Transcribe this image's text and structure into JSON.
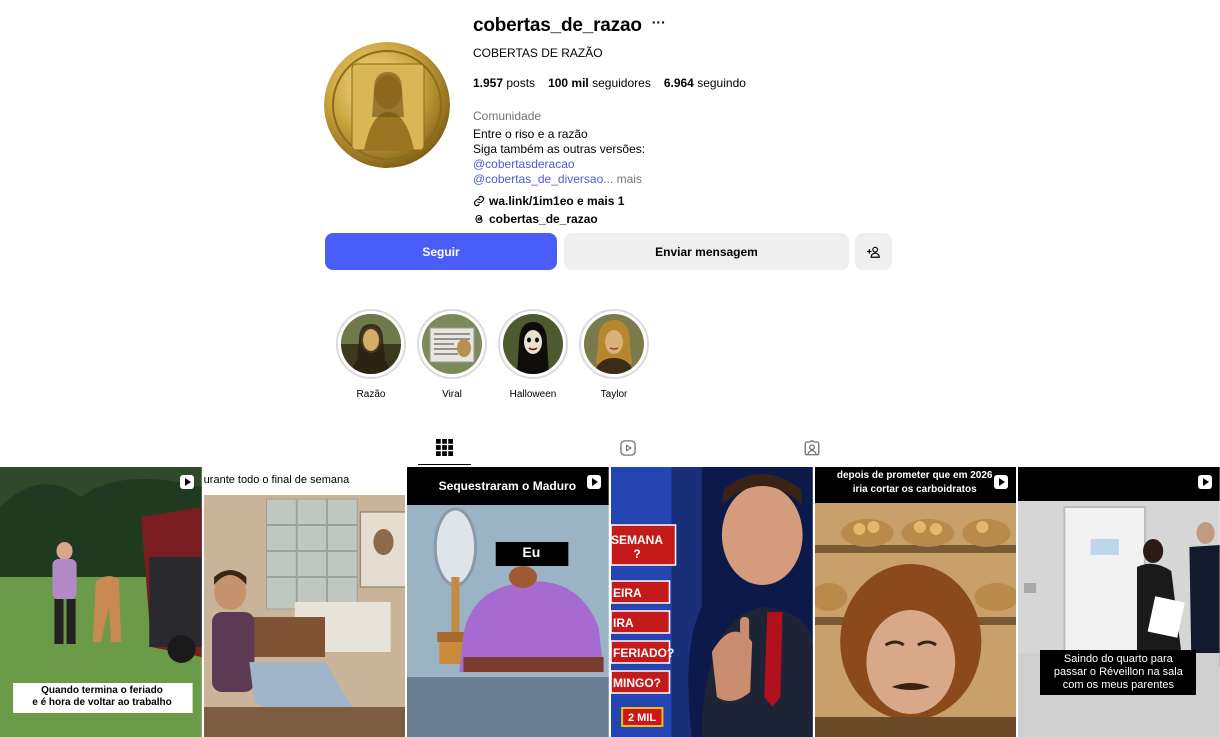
{
  "profile": {
    "username": "cobertas_de_razao",
    "more": "···",
    "full_name": "COBERTAS DE RAZÃO",
    "stats": {
      "posts_count": "1.957",
      "posts_label": "posts",
      "followers_count": "100 mil",
      "followers_label": "seguidores",
      "following_count": "6.964",
      "following_label": "seguindo"
    },
    "category": "Comunidade",
    "bio_line1": "Entre o riso e a razão",
    "bio_line2": "Siga também as outras versões:",
    "bio_link1": "@cobertasderacao",
    "bio_link2": "@cobertas_de_diversao...",
    "bio_more": "mais",
    "external_link": "wa.link/1im1eo e mais 1",
    "threads_handle": "cobertas_de_razao"
  },
  "actions": {
    "follow": "Seguir",
    "message": "Enviar mensagem"
  },
  "highlights": [
    {
      "label": "Razão"
    },
    {
      "label": "Viral"
    },
    {
      "label": "Halloween"
    },
    {
      "label": "Taylor"
    }
  ],
  "posts": [
    {
      "caption_line1": "Quando termina o feriado",
      "caption_line2": "e é hora de voltar ao trabalho"
    },
    {
      "caption": "urante todo o final de semana"
    },
    {
      "caption": "Sequestraram o Maduro",
      "label": "Eu"
    },
    {
      "bar1": "SEMANA",
      "bar1b": "?",
      "bar2": "EIRA",
      "bar3": "IRA",
      "bar4": "FERIADO?",
      "bar5": "MINGO?",
      "prize": "2 MIL"
    },
    {
      "caption_line1": "depois de prometer que em 2026",
      "caption_line2": "iria cortar os carboidratos"
    },
    {
      "caption_line1": "Saindo do quarto para",
      "caption_line2": "passar o Réveillon na sala",
      "caption_line3": "com os meus parentes"
    }
  ],
  "colors": {
    "follow_button": "#4a5df9",
    "secondary_button": "#efefef",
    "link": "#4a5bd6",
    "muted": "#737373"
  }
}
